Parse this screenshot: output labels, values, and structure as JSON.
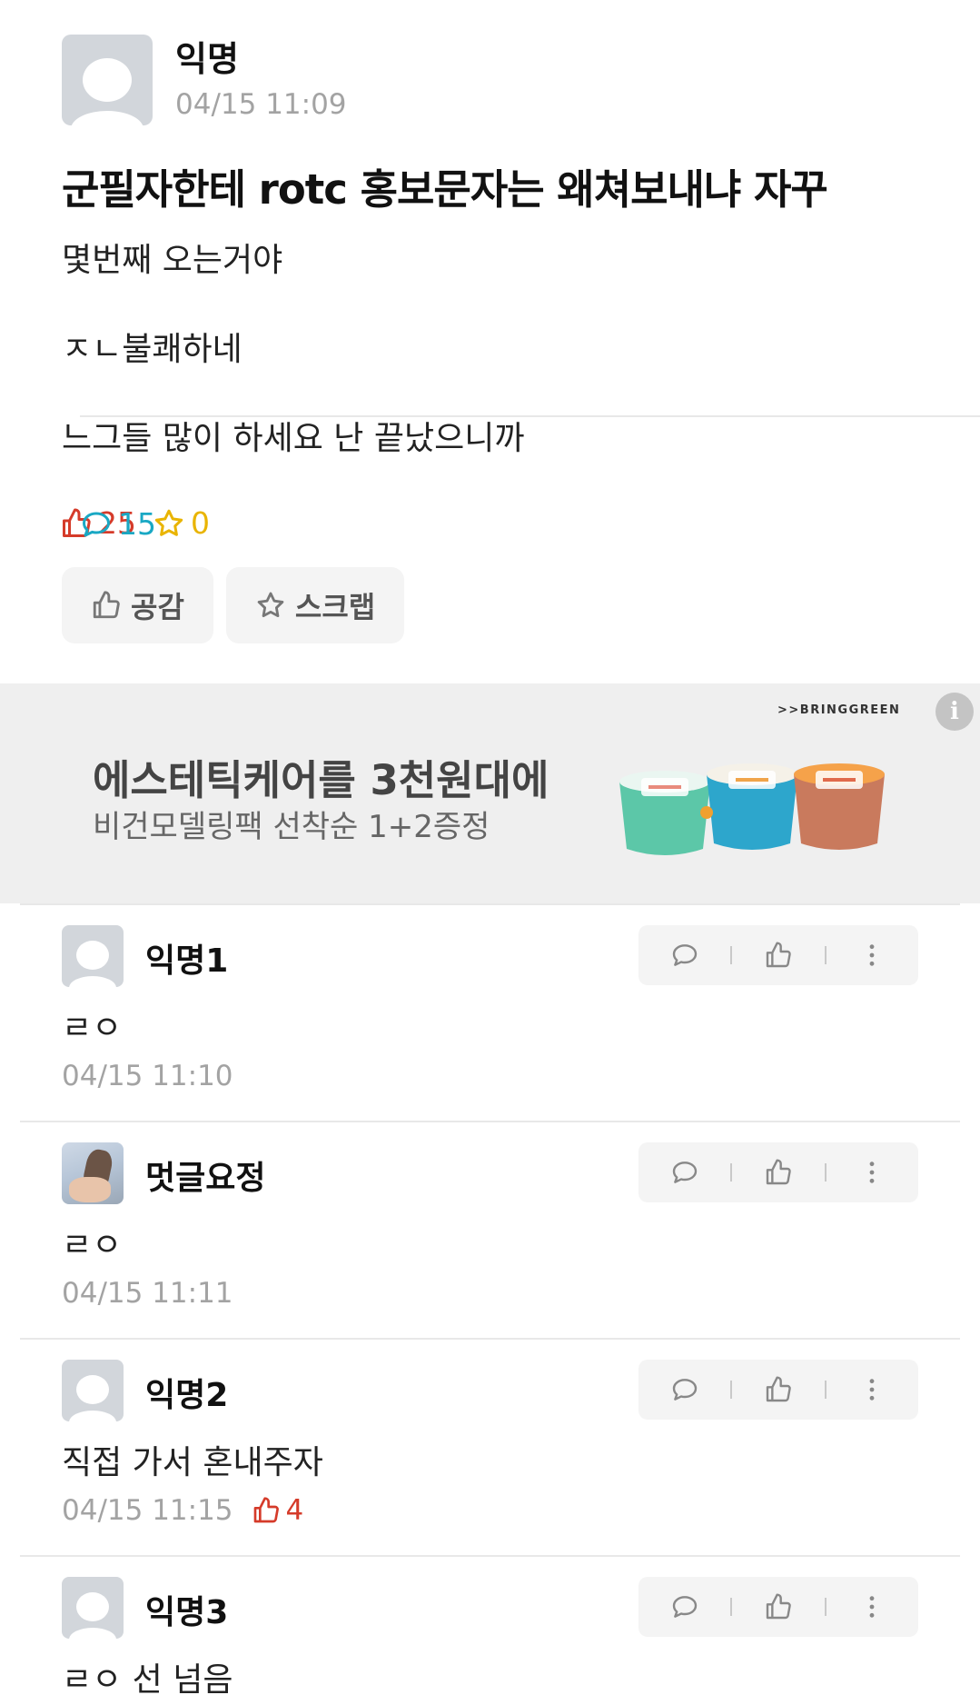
{
  "post": {
    "author": "익명",
    "time": "04/15 11:09",
    "title": "군필자한테 rotc 홍보문자는 왜쳐보내냐 자꾸",
    "body": [
      "몇번째 오는거야",
      "ㅈㄴ불쾌하네",
      "느그들 많이 하세요 난 끝났으니까"
    ],
    "likes": "25",
    "comments": "15",
    "scraps": "0",
    "like_button": "공감",
    "scrap_button": "스크랩"
  },
  "ad": {
    "brand": ">>BRINGGREEN",
    "title": "에스테틱케어를 3천원대에",
    "subtitle": "비건모델링팩 선착순 1+2증정",
    "info_glyph": "i"
  },
  "comments": [
    {
      "name": "익명1",
      "text": "ㄹㅇ",
      "time": "04/15 11:10",
      "likes": ""
    },
    {
      "name": "멋글요정",
      "text": "ㄹㅇ",
      "time": "04/15 11:11",
      "likes": ""
    },
    {
      "name": "익명2",
      "text": "직접 가서 혼내주자",
      "time": "04/15 11:15",
      "likes": "4"
    },
    {
      "name": "익명3",
      "text": "ㄹㅇ 선 넘음",
      "time": "",
      "likes": ""
    }
  ],
  "colors": {
    "like": "#d53b2a",
    "comment": "#19a8c4",
    "scrap": "#e9b400",
    "muted": "#a3a3a3"
  }
}
